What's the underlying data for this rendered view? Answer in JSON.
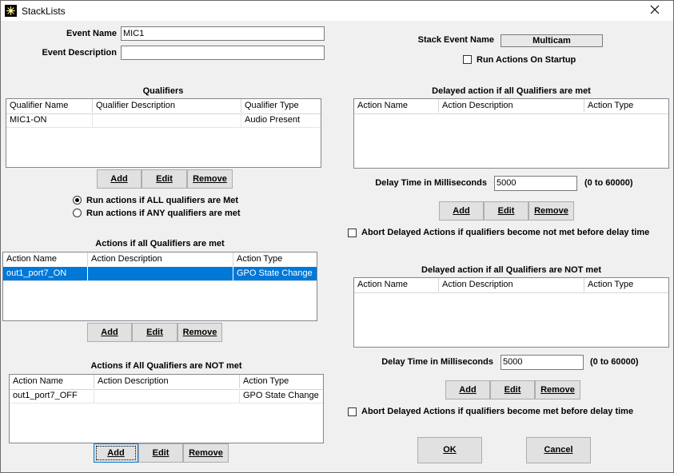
{
  "window": {
    "title": "StackLists",
    "close_icon": "close-icon"
  },
  "event": {
    "name_label": "Event Name",
    "name_value": "MIC1",
    "description_label": "Event Description",
    "description_value": ""
  },
  "stack": {
    "name_label": "Stack Event Name",
    "name_value": "Multicam",
    "run_on_startup_label": "Run Actions On Startup",
    "run_on_startup_checked": false
  },
  "qualifiers": {
    "title": "Qualifiers",
    "columns": [
      "Qualifier Name",
      "Qualifier Description",
      "Qualifier Type"
    ],
    "rows": [
      [
        "MIC1-ON",
        "",
        "Audio Present"
      ]
    ],
    "add": "Add",
    "edit": "Edit",
    "remove": "Remove",
    "radio_all": "Run actions if ALL qualifiers are Met",
    "radio_any": "Run actions if ANY qualifiers are met",
    "selected_mode": "all"
  },
  "actions_met": {
    "title": "Actions if all Qualifiers are met",
    "columns": [
      "Action Name",
      "Action Description",
      "Action Type"
    ],
    "rows": [
      [
        "out1_port7_ON",
        "",
        "GPO State Change"
      ]
    ],
    "add": "Add",
    "edit": "Edit",
    "remove": "Remove"
  },
  "actions_not_met": {
    "title": "Actions if All Qualifiers are NOT met",
    "columns": [
      "Action Name",
      "Action Description",
      "Action Type"
    ],
    "rows": [
      [
        "out1_port7_OFF",
        "",
        "GPO State Change"
      ]
    ],
    "add": "Add",
    "edit": "Edit",
    "remove": "Remove"
  },
  "delayed_met": {
    "title": "Delayed action if all Qualifiers are met",
    "columns": [
      "Action Name",
      "Action Description",
      "Action Type"
    ],
    "delay_label": "Delay Time in Milliseconds",
    "delay_value": "5000",
    "range": "(0 to 60000)",
    "add": "Add",
    "edit": "Edit",
    "remove": "Remove",
    "abort_label": "Abort Delayed Actions if qualifiers become not met before delay time",
    "abort_checked": false
  },
  "delayed_not_met": {
    "title": "Delayed action if all Qualifiers are NOT met",
    "columns": [
      "Action Name",
      "Action Description",
      "Action Type"
    ],
    "delay_label": "Delay Time in Milliseconds",
    "delay_value": "5000",
    "range": "(0 to 60000)",
    "add": "Add",
    "edit": "Edit",
    "remove": "Remove",
    "abort_label": "Abort Delayed Actions if qualifiers become met before delay time",
    "abort_checked": false
  },
  "footer": {
    "ok": "OK",
    "cancel": "Cancel"
  }
}
